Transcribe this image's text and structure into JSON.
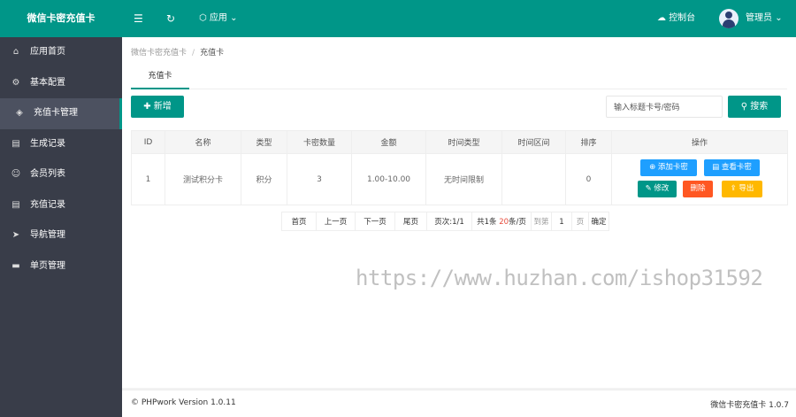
{
  "header": {
    "logo": "微信卡密充值卡",
    "apps_label": "应用",
    "console_label": "控制台",
    "user_label": "管理员"
  },
  "sidebar": {
    "items": [
      {
        "label": "应用首页",
        "icon": "home-icon"
      },
      {
        "label": "基本配置",
        "icon": "gear-icon"
      },
      {
        "label": "充值卡管理",
        "icon": "layers-icon",
        "active": true
      },
      {
        "label": "生成记录",
        "icon": "document-icon"
      },
      {
        "label": "会员列表",
        "icon": "user-icon"
      },
      {
        "label": "充值记录",
        "icon": "document-icon"
      },
      {
        "label": "导航管理",
        "icon": "navigation-icon"
      },
      {
        "label": "单页管理",
        "icon": "file-icon"
      }
    ]
  },
  "breadcrumb": {
    "root": "微信卡密充值卡",
    "separator": "/",
    "current": "充值卡"
  },
  "tabs": [
    "充值卡"
  ],
  "toolbar": {
    "add_label": "新增",
    "search_placeholder": "输入标题卡号/密码",
    "search_label": "搜索"
  },
  "table": {
    "headers": [
      "ID",
      "名称",
      "类型",
      "卡密数量",
      "金额",
      "时间类型",
      "时间区间",
      "排序",
      "操作"
    ],
    "rows": [
      {
        "id": "1",
        "name": "测试积分卡",
        "type": "积分",
        "count": "3",
        "amount": "1.00-10.00",
        "time_type": "无时间限制",
        "time_range": "",
        "sort": "0"
      }
    ],
    "actions": {
      "add_card": "添加卡密",
      "view_card": "查看卡密",
      "edit": "修改",
      "delete": "删除",
      "export": "导出"
    }
  },
  "pagination": {
    "first": "首页",
    "prev": "上一页",
    "next": "下一页",
    "last": "尾页",
    "page_info": "页次:1/1",
    "total_prefix": "共1条",
    "per_page_num": "20",
    "per_page_suffix": "条/页",
    "goto_label": "到第",
    "page_value": "1",
    "page_unit": "页",
    "confirm": "确定"
  },
  "watermark": "https://www.huzhan.com/ishop31592",
  "footer": {
    "copyright": "© PHPwork Version 1.0.11",
    "product": "微信卡密充值卡 1.0.7"
  },
  "colors": {
    "primary": "#009688",
    "sidebar": "#393d49",
    "blue": "#1e9fff",
    "red": "#ff5722",
    "orange": "#ffb800"
  }
}
